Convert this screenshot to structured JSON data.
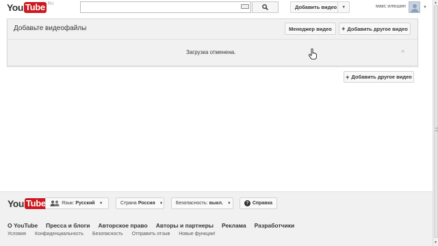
{
  "header": {
    "logo_you": "You",
    "logo_tube": "Tube",
    "logo_region": "RU",
    "search_value": "",
    "upload_label": "Добавить видео",
    "username": "макс илюшин"
  },
  "panel": {
    "title": "Добавьте видеофайлы",
    "manager_label": "Менеджер видео",
    "add_other_label": "Добавить другое видео",
    "status_text": "Загрузка отменена.",
    "close_glyph": "×"
  },
  "main": {
    "add_other_label": "Добавить другое видео"
  },
  "footer": {
    "logo_you": "You",
    "logo_tube": "Tube",
    "language_prefix": "Язык:",
    "language_value": "Русский",
    "country_prefix": "Страна",
    "country_value": "Россия",
    "safety_prefix": "Безопасность:",
    "safety_value": "выкл.",
    "help_label": "Справка",
    "primary_links": [
      "О YouTube",
      "Пресса и блоги",
      "Авторское право",
      "Авторы и партнеры",
      "Реклама",
      "Разработчики"
    ],
    "secondary_links": [
      "Условия",
      "Конфиденциальность",
      "Безопасность",
      "Отправить отзыв",
      "Новые функции!"
    ]
  },
  "colors": {
    "brand_red": "#cc181e",
    "panel_bg": "#f1f1f1",
    "footer_bg": "#f1f1f1"
  }
}
